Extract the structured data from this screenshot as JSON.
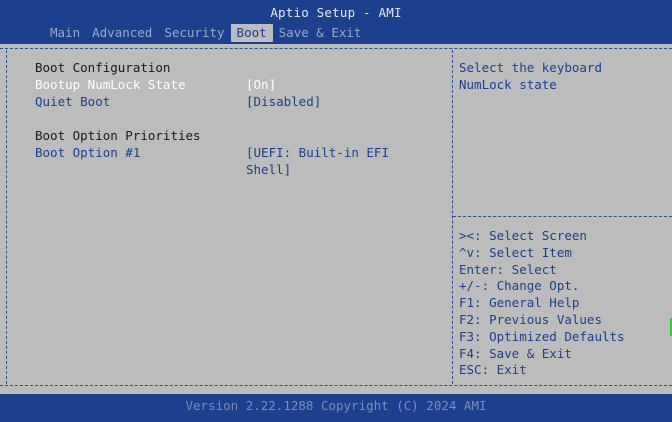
{
  "header": {
    "title": "Aptio Setup - AMI",
    "tabs": [
      {
        "label": "Main"
      },
      {
        "label": "Advanced"
      },
      {
        "label": "Security"
      },
      {
        "label": "Boot"
      },
      {
        "label": "Save & Exit"
      }
    ],
    "active_tab": "Boot"
  },
  "settings": {
    "section_boot_config": "Boot Configuration",
    "numlock_label": "Bootup NumLock State",
    "numlock_value": "[On]",
    "quiet_boot_label": "Quiet Boot",
    "quiet_boot_value": "[Disabled]",
    "section_priorities": "Boot Option Priorities",
    "boot_option1_label": "Boot Option #1",
    "boot_option1_value_line1": "[UEFI: Built-in EFI",
    "boot_option1_value_line2": "Shell]"
  },
  "help": {
    "line1": "Select the keyboard",
    "line2": "NumLock state"
  },
  "keys": [
    "><: Select Screen",
    "^v: Select Item",
    "Enter: Select",
    "+/-: Change Opt.",
    "F1: General Help",
    "F2: Previous Values",
    "F3: Optimized Defaults",
    "F4: Save & Exit",
    "ESC: Exit"
  ],
  "footer": {
    "version": "Version 2.22.1288 Copyright (C) 2024 AMI"
  },
  "colors": {
    "background_blue": "#1c3f8e",
    "panel_gray": "#bcbcbc",
    "highlight_white": "#ffffff",
    "text_blue": "#1c3f8e"
  }
}
